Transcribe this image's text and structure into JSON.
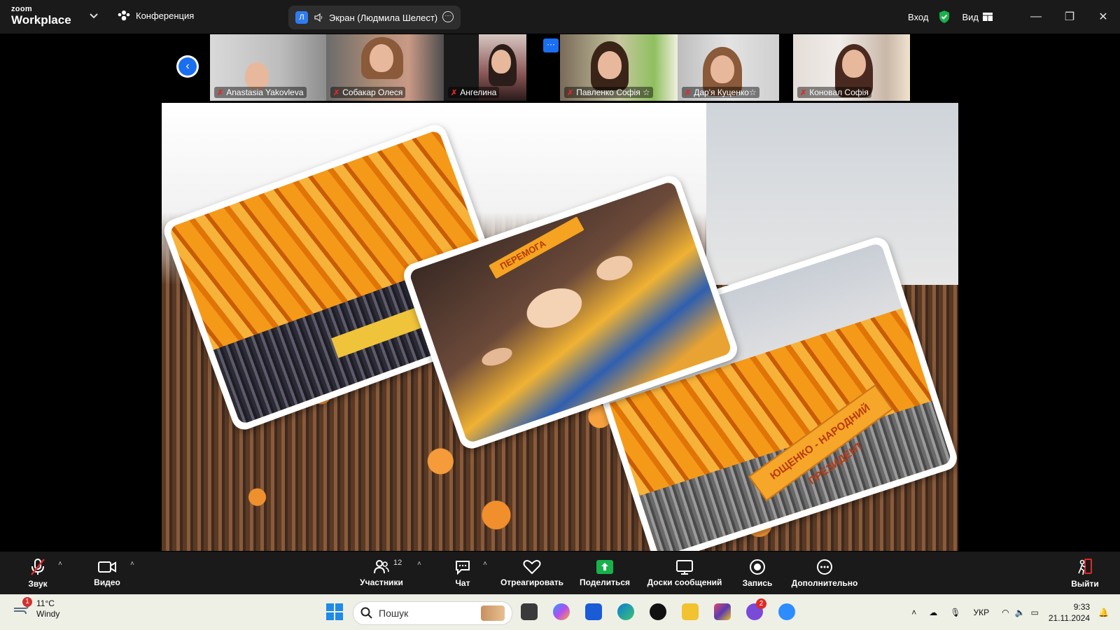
{
  "titlebar": {
    "logo_top": "zoom",
    "logo_bottom": "Workplace",
    "meeting_label": "Конференция",
    "share_avatar": "Л",
    "share_label": "Экран (Людмила Шелест)",
    "signin": "Вход",
    "view": "Вид"
  },
  "participants": [
    {
      "name": "Anastasia Yakovleva"
    },
    {
      "name": "Собакар Олеся"
    },
    {
      "name": "Ангелина"
    },
    {
      "name": "Павленко Софія ☆"
    },
    {
      "name": "Дар'я Куценко☆"
    },
    {
      "name": "Коновал Софія"
    }
  ],
  "thumb_more": "···",
  "slide": {
    "banner_text": "ЮЩЕНКО - НАРОДНИЙ ПРЕЗИДЕНТ",
    "ribbon_text": "ПЕРЕМОГА"
  },
  "toolbar": {
    "audio": "Звук",
    "video": "Видео",
    "participants": "Участники",
    "participants_count": "12",
    "chat": "Чат",
    "react": "Отреагировать",
    "share": "Поделиться",
    "whiteboards": "Доски сообщений",
    "record": "Запись",
    "more": "Дополнительно",
    "leave": "Выйти"
  },
  "taskbar": {
    "weather_temp": "11°C",
    "weather_desc": "Windy",
    "weather_badge": "1",
    "search_placeholder": "Пошук",
    "viber_badge": "2",
    "lang": "УКР",
    "time": "9:33",
    "date": "21.11.2024"
  },
  "colors": {
    "accent_blue": "#1a6ff0",
    "share_green": "#18b14b",
    "mic_off_red": "#e02828",
    "orange": "#f59a18"
  }
}
